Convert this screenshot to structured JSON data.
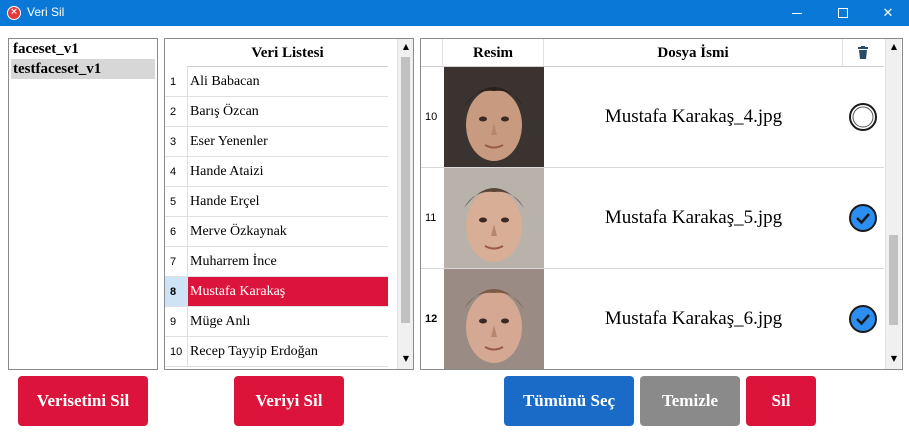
{
  "window": {
    "title": "Veri Sil",
    "accent": "#0a78d7"
  },
  "datasets": {
    "items": [
      {
        "label": "faceset_v1",
        "selected": false
      },
      {
        "label": "testfaceset_v1",
        "selected": true
      }
    ]
  },
  "data_list": {
    "header": "Veri Listesi",
    "rows": [
      {
        "num": "1",
        "name": "Ali Babacan"
      },
      {
        "num": "2",
        "name": "Barış Özcan"
      },
      {
        "num": "3",
        "name": "Eser Yenenler"
      },
      {
        "num": "4",
        "name": "Hande Ataizi"
      },
      {
        "num": "5",
        "name": "Hande Erçel"
      },
      {
        "num": "6",
        "name": "Merve Özkaynak"
      },
      {
        "num": "7",
        "name": "Muharrem İnce"
      },
      {
        "num": "8",
        "name": "Mustafa Karakaş",
        "selected": true
      },
      {
        "num": "9",
        "name": "Müge Anlı"
      },
      {
        "num": "10",
        "name": "Recep Tayyip Erdoğan"
      }
    ]
  },
  "image_grid": {
    "headers": {
      "image": "Resim",
      "file": "Dosya İsmi",
      "delete_icon": "trash-icon"
    },
    "rows": [
      {
        "num": "10",
        "file": "Mustafa Karakaş_4.jpg",
        "checked": false
      },
      {
        "num": "11",
        "file": "Mustafa Karakaş_5.jpg",
        "checked": true
      },
      {
        "num": "12",
        "file": "Mustafa Karakaş_6.jpg",
        "checked": true
      }
    ]
  },
  "buttons": {
    "delete_dataset": "Verisetini Sil",
    "delete_data": "Veriyi Sil",
    "select_all": "Tümünü Seç",
    "clear": "Temizle",
    "delete": "Sil"
  },
  "colors": {
    "danger": "#dc143c",
    "primary": "#1a6ac8",
    "neutral": "#8a8a8a",
    "check": "#2b8ef0"
  }
}
